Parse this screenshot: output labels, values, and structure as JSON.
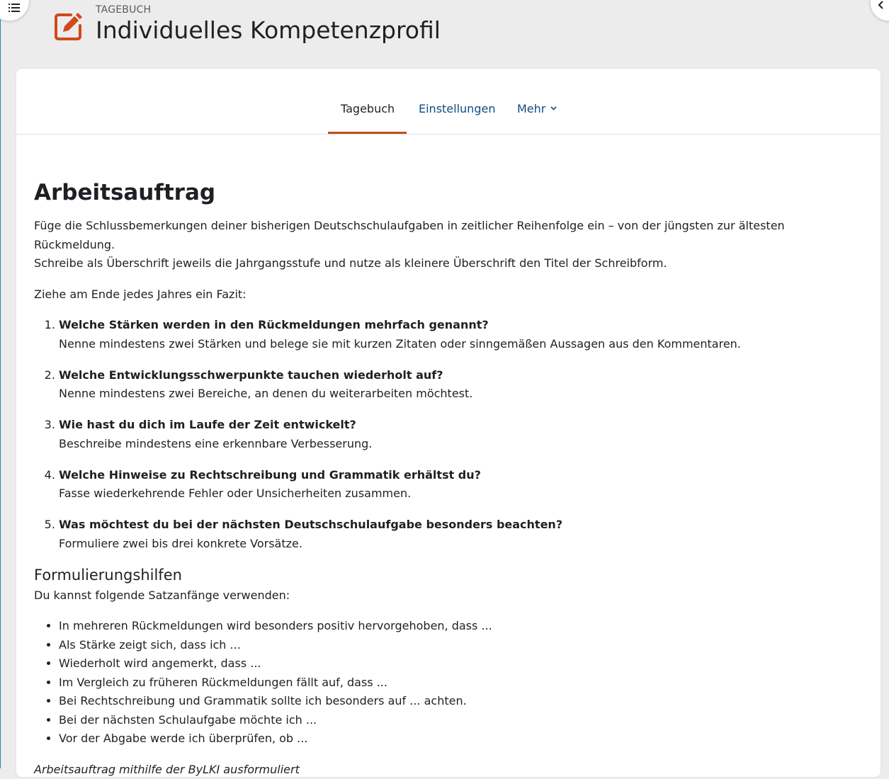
{
  "header": {
    "pretitle": "TAGEBUCH",
    "title": "Individuelles Kompetenzprofil",
    "icon": "edit-note-icon",
    "accent_color": "#d1491c"
  },
  "drawer_toggle": {
    "icon": "list-icon"
  },
  "index_toggle": {
    "icon": "chevron-left-icon"
  },
  "nav": {
    "tabs": [
      {
        "label": "Tagebuch",
        "active": true
      },
      {
        "label": "Einstellungen",
        "active": false
      },
      {
        "label": "Mehr",
        "active": false
      }
    ],
    "active_color": "#c24e1f",
    "link_color": "#0f4c81"
  },
  "content": {
    "heading": "Arbeitsauftrag",
    "intro_line1": "Füge die Schlussbemerkungen deiner bisherigen Deutschschulaufgaben in zeitlicher Reihenfolge ein – von der jüngsten zur ältesten Rückmeldung.",
    "intro_line2": "Schreibe als Überschrift jeweils die Jahrgangsstufe und nutze als kleinere Überschrift den Titel der Schreibform.",
    "fazit": "Ziehe am Ende jedes Jahres ein Fazit:",
    "tasks": [
      {
        "question": "Welche Stärken werden in den Rückmeldungen mehrfach genannt?",
        "detail": "Nenne mindestens zwei Stärken und belege sie mit kurzen Zitaten oder sinngemäßen Aussagen aus den Kommentaren."
      },
      {
        "question": "Welche Entwicklungsschwerpunkte tauchen wiederholt auf?",
        "detail": "Nenne mindestens zwei Bereiche, an denen du weiterarbeiten möchtest."
      },
      {
        "question": "Wie hast du dich im Laufe der Zeit entwickelt?",
        "detail": "Beschreibe mindestens eine erkennbare Verbesserung."
      },
      {
        "question": "Welche Hinweise zu Rechtschreibung und Grammatik erhältst du?",
        "detail": "Fasse wiederkehrende Fehler oder Unsicherheiten zusammen."
      },
      {
        "question": "Was möchtest du bei der nächsten Deutschschulaufgabe besonders beachten?",
        "detail": "Formuliere zwei bis drei konkrete Vorsätze."
      }
    ],
    "subheading": "Formulierungshilfen",
    "hint": "Du kannst folgende Satzanfänge verwenden:",
    "phrases": [
      "In mehreren Rückmeldungen wird besonders positiv hervorgehoben, dass ...",
      "Als Stärke zeigt sich, dass ich ...",
      "Wiederholt wird angemerkt, dass ...",
      "Im Vergleich zu früheren Rückmeldungen fällt auf, dass ...",
      "Bei Rechtschreibung und Grammatik sollte ich besonders auf ... achten.",
      "Bei der nächsten Schulaufgabe möchte ich ...",
      "Vor der Abgabe werde ich überprüfen, ob ..."
    ],
    "credit": "Arbeitsauftrag mithilfe der ByLKI ausformuliert"
  }
}
